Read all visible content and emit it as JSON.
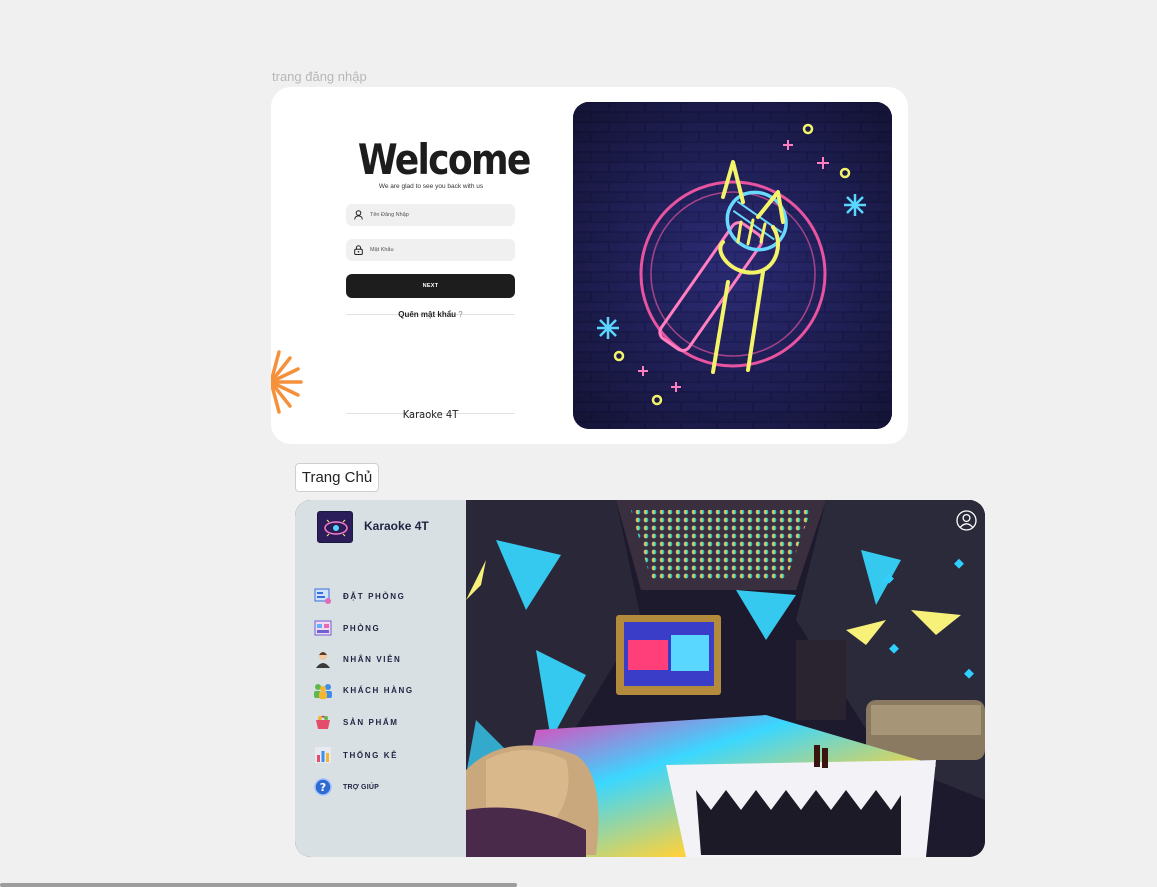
{
  "login": {
    "frame_label": "trang đăng nhập",
    "welcome": "Welcome",
    "subtitle": "We are glad to see you back with us",
    "username_placeholder": "Tên Đăng Nhập",
    "password_placeholder": "Mật Khẩu",
    "next_label": "NEXT",
    "forgot_label": "Quên mật khẩu",
    "forgot_mark": "?",
    "brand": "Karaoke 4T"
  },
  "home": {
    "frame_label": "Trang Chủ",
    "ghost_label": "",
    "brand": "Karaoke 4T",
    "nav": [
      {
        "label": "ĐẶT PHÒNG",
        "icon": "booking-icon"
      },
      {
        "label": "PHÒNG",
        "icon": "room-icon"
      },
      {
        "label": "NHÂN VIÊN",
        "icon": "staff-icon"
      },
      {
        "label": "KHÁCH HÀNG",
        "icon": "customers-icon"
      },
      {
        "label": "SẢN PHẨM",
        "icon": "products-icon"
      },
      {
        "label": "THỐNG KÊ",
        "icon": "statistics-icon"
      },
      {
        "label": "TRỢ GIÚP",
        "icon": "help-icon"
      }
    ]
  },
  "colors": {
    "accent_dark": "#1d1d1d",
    "sidebar_bg": "#d9e0e4",
    "neon_yellow": "#f4f46a",
    "neon_pink": "#ff5aa8",
    "neon_blue": "#5ad7ff",
    "burst_orange": "#f6913b"
  }
}
